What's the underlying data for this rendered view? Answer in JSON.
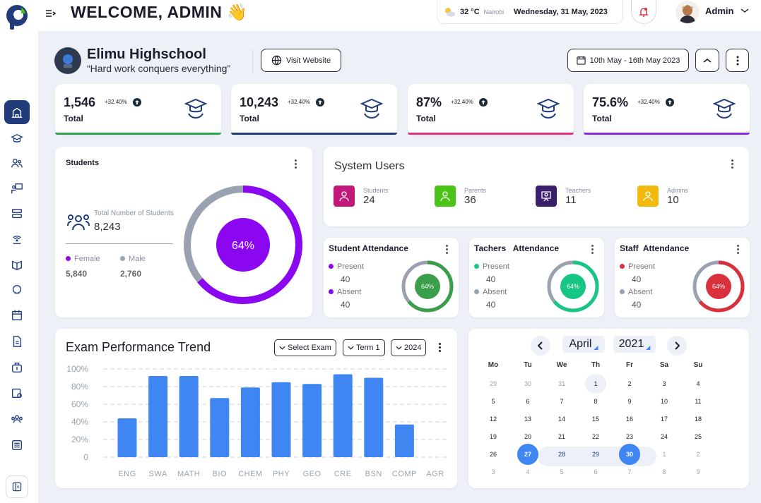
{
  "header": {
    "welcome": "WELCOME, ADMIN",
    "wave": "👋",
    "temperature": "32 °C",
    "city": "Nairobi",
    "date": "Wednesday, 31 May, 2023",
    "user": "Admin"
  },
  "school": {
    "name": "Elimu Highschool",
    "motto": "“Hard work conquers everything”",
    "visit_label": "Visit Website",
    "date_range": "10th May - 16th May 2023"
  },
  "stats": [
    {
      "value": "1,546",
      "change": "+32.40%",
      "label": "Total",
      "color": "#2ea44f"
    },
    {
      "value": "10,243",
      "change": "+32.40%",
      "label": "Total",
      "color": "#213b7b"
    },
    {
      "value": "87%",
      "change": "+32.40%",
      "label": "Total",
      "color": "#e0357a"
    },
    {
      "value": "75.6%",
      "change": "+32.40%",
      "label": "Total",
      "color": "#8a2be2"
    }
  ],
  "students": {
    "title": "Students",
    "total_label": "Total Number of Students",
    "total": "8,243",
    "female_label": "Female",
    "female": "5,840",
    "male_label": "Male",
    "male": "2,760",
    "percent_label": "64%",
    "percent": 64
  },
  "system_users": {
    "title": "System Users",
    "items": [
      {
        "label": "Students",
        "value": "24",
        "color": "#c2187a",
        "icon": "student-icon"
      },
      {
        "label": "Parents",
        "value": "36",
        "color": "#4cc417",
        "icon": "parent-icon"
      },
      {
        "label": "Teachers",
        "value": "11",
        "color": "#3a1f6b",
        "icon": "teacher-icon"
      },
      {
        "label": "Admins",
        "value": "10",
        "color": "#f2b90f",
        "icon": "admin-icon"
      }
    ]
  },
  "attendance": [
    {
      "title": "Student Attendance",
      "present_label": "Present",
      "present": "40",
      "absent_label": "Absent",
      "absent": "40",
      "percent_label": "64%",
      "percent": 64,
      "color": "#3a9e4a",
      "present_color": "#8a07f0",
      "absent_color": "#8a07f0"
    },
    {
      "title": "Tachers   Attendance",
      "present_label": "Present",
      "present": "40",
      "absent_label": "Absent",
      "absent": "40",
      "percent_label": "64%",
      "percent": 64,
      "color": "#16c784",
      "present_color": "#16c784",
      "absent_color": "#9aa1b0"
    },
    {
      "title": "Staff  Attendance",
      "present_label": "Present",
      "present": "40",
      "absent_label": "Absent",
      "absent": "40",
      "percent_label": "64%",
      "percent": 64,
      "color": "#d9303e",
      "present_color": "#d9303e",
      "absent_color": "#9aa1b0"
    }
  ],
  "exam": {
    "title": "Exam Performance Trend",
    "select_exam": "Select Exam",
    "term": "Term 1",
    "year": "2024"
  },
  "chart_data": {
    "type": "bar",
    "categories": [
      "ENG",
      "SWA",
      "MATH",
      "BIO",
      "CHEM",
      "PHY",
      "GEO",
      "CRE",
      "BSN",
      "COMP",
      "AGR"
    ],
    "values": [
      44,
      92,
      92,
      67,
      79,
      85,
      83,
      94,
      90,
      37
    ],
    "values_full": [
      44,
      92,
      92,
      67,
      79,
      85,
      83,
      94,
      90,
      37
    ],
    "ylim": [
      0,
      100
    ],
    "yticks": [
      "0",
      "20%",
      "40%",
      "60%",
      "80%",
      "100%"
    ],
    "grid": true,
    "color": "#3f86f2"
  },
  "calendar": {
    "month": "April",
    "year": "2021",
    "weekdays": [
      "Mo",
      "Tu",
      "We",
      "Th",
      "Fr",
      "Sa",
      "Su"
    ],
    "weeks": [
      [
        "29",
        "30",
        "31",
        "1",
        "2",
        "3",
        "4"
      ],
      [
        "5",
        "6",
        "7",
        "8",
        "9",
        "10",
        "11"
      ],
      [
        "12",
        "13",
        "14",
        "15",
        "16",
        "17",
        "18"
      ],
      [
        "19",
        "20",
        "21",
        "22",
        "23",
        "24",
        "25"
      ],
      [
        "26",
        "27",
        "28",
        "29",
        "30",
        "1",
        "2"
      ],
      [
        "3",
        "4",
        "5",
        "6",
        "7",
        "8",
        "9"
      ]
    ]
  }
}
